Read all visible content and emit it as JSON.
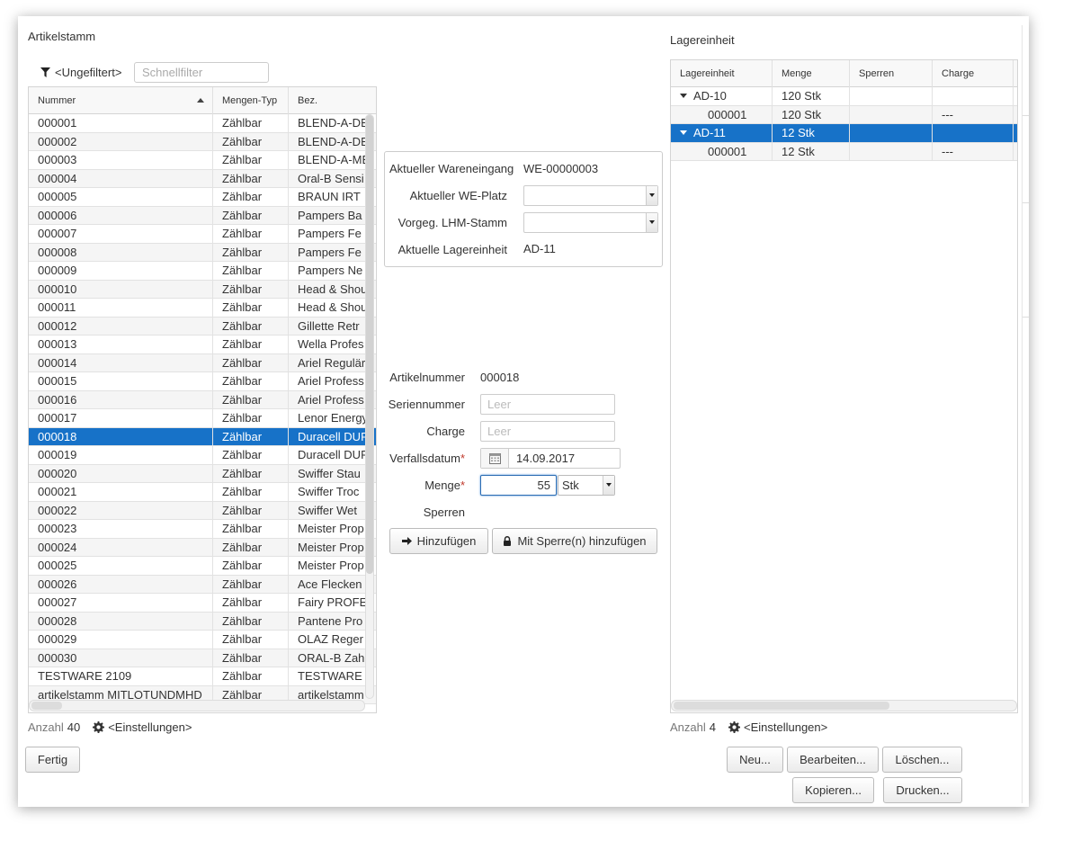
{
  "left_panel": {
    "title": "Artikelstamm",
    "filter_label": "<Ungefiltert>",
    "quick_filter_placeholder": "Schnellfilter",
    "columns": [
      "Nummer",
      "Mengen-Typ",
      "Bez."
    ],
    "rows": [
      [
        "000001",
        "Zählbar",
        "BLEND-A-DE"
      ],
      [
        "000002",
        "Zählbar",
        "BLEND-A-DE"
      ],
      [
        "000003",
        "Zählbar",
        "BLEND-A-ME"
      ],
      [
        "000004",
        "Zählbar",
        "Oral-B Sensi"
      ],
      [
        "000005",
        "Zählbar",
        "BRAUN IRT"
      ],
      [
        "000006",
        "Zählbar",
        "Pampers Ba"
      ],
      [
        "000007",
        "Zählbar",
        "Pampers Fe"
      ],
      [
        "000008",
        "Zählbar",
        "Pampers Fe"
      ],
      [
        "000009",
        "Zählbar",
        "Pampers Ne"
      ],
      [
        "000010",
        "Zählbar",
        "Head & Shou"
      ],
      [
        "000011",
        "Zählbar",
        "Head & Shou"
      ],
      [
        "000012",
        "Zählbar",
        "Gillette Retr"
      ],
      [
        "000013",
        "Zählbar",
        "Wella Profes"
      ],
      [
        "000014",
        "Zählbar",
        "Ariel Regulär"
      ],
      [
        "000015",
        "Zählbar",
        "Ariel Profess"
      ],
      [
        "000016",
        "Zählbar",
        "Ariel Profess"
      ],
      [
        "000017",
        "Zählbar",
        "Lenor Energy"
      ],
      [
        "000018",
        "Zählbar",
        "Duracell DUF"
      ],
      [
        "000019",
        "Zählbar",
        "Duracell DUF"
      ],
      [
        "000020",
        "Zählbar",
        "Swiffer Stau"
      ],
      [
        "000021",
        "Zählbar",
        "Swiffer Troc"
      ],
      [
        "000022",
        "Zählbar",
        "Swiffer Wet"
      ],
      [
        "000023",
        "Zählbar",
        "Meister Prop"
      ],
      [
        "000024",
        "Zählbar",
        "Meister Prop"
      ],
      [
        "000025",
        "Zählbar",
        "Meister Prop"
      ],
      [
        "000026",
        "Zählbar",
        "Ace Flecken"
      ],
      [
        "000027",
        "Zählbar",
        "Fairy PROFE"
      ],
      [
        "000028",
        "Zählbar",
        "Pantene Pro"
      ],
      [
        "000029",
        "Zählbar",
        "OLAZ Reger"
      ],
      [
        "000030",
        "Zählbar",
        "ORAL-B Zah"
      ],
      [
        "TESTWARE 2109",
        "Zählbar",
        "TESTWARE"
      ],
      [
        "artikelstamm MITLOTUNDMHD",
        "Zählbar",
        "artikelstamm"
      ]
    ],
    "selected_row": 17,
    "count_label": "Anzahl",
    "count_value": "40",
    "settings_label": "<Einstellungen>",
    "done_button": "Fertig"
  },
  "info_box": {
    "wareneingang_label": "Aktueller Wareneingang",
    "wareneingang_value": "WE-00000003",
    "we_platz_label": "Aktueller WE-Platz",
    "lhm_label": "Vorgeg. LHM-Stamm",
    "lagereinheit_label": "Aktuelle Lagereinheit",
    "lagereinheit_value": "AD-11"
  },
  "form": {
    "artikelnummer_label": "Artikelnummer",
    "artikelnummer_value": "000018",
    "seriennummer_label": "Seriennummer",
    "seriennummer_placeholder": "Leer",
    "charge_label": "Charge",
    "charge_placeholder": "Leer",
    "verfallsdatum_label": "Verfallsdatum",
    "verfallsdatum_value": "14.09.2017",
    "menge_label": "Menge",
    "menge_value": "55",
    "unit_value": "Stk",
    "sperren_label": "Sperren",
    "required_mark": "*",
    "add_button": "Hinzufügen",
    "add_locked_button": "Mit Sperre(n) hinzufügen"
  },
  "right_panel": {
    "title": "Lagereinheit",
    "columns": [
      "Lagereinheit",
      "Menge",
      "Sperren",
      "Charge"
    ],
    "rows": [
      {
        "unit": "AD-10",
        "qty": "120 Stk",
        "locks": "",
        "charge": "",
        "expanded": true,
        "child": false
      },
      {
        "unit": "000001",
        "qty": "120 Stk",
        "locks": "",
        "charge": "---",
        "expanded": false,
        "child": true
      },
      {
        "unit": "AD-11",
        "qty": "12 Stk",
        "locks": "",
        "charge": "",
        "expanded": true,
        "child": false
      },
      {
        "unit": "000001",
        "qty": "12 Stk",
        "locks": "",
        "charge": "---",
        "expanded": false,
        "child": true
      }
    ],
    "selected_row": 2,
    "count_label": "Anzahl",
    "count_value": "4",
    "settings_label": "<Einstellungen>",
    "buttons": {
      "new": "Neu...",
      "edit": "Bearbeiten...",
      "delete": "Löschen...",
      "copy": "Kopieren...",
      "print": "Drucken..."
    }
  },
  "colors": {
    "selection": "#1772c8",
    "required": "#c0392b"
  }
}
